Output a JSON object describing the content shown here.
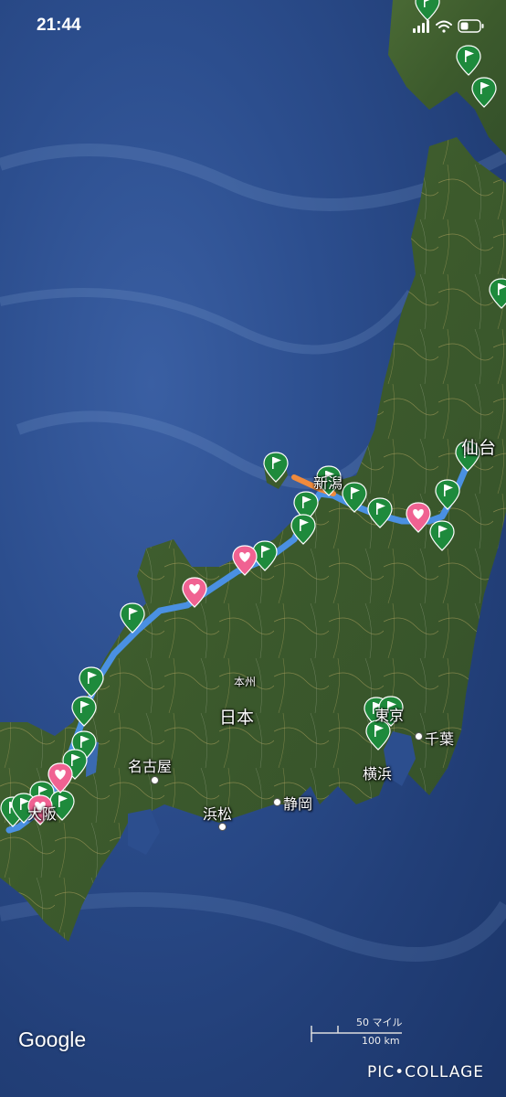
{
  "status_bar": {
    "time": "21:44"
  },
  "labels": {
    "sendai": "仙台",
    "niigata": "新潟",
    "honshu": "本州",
    "japan": "日本",
    "tokyo": "東京",
    "chiba": "千葉",
    "yokohama": "横浜",
    "nagoya": "名古屋",
    "hamamatsu": "浜松",
    "shizuoka": "静岡",
    "osaka": "大阪"
  },
  "attribution": {
    "logo": "Google"
  },
  "scale": {
    "imperial": "50 マイル",
    "metric": "100 km"
  },
  "watermark": "PIC•COLLAGE",
  "colors": {
    "route_primary": "#4a90e2",
    "route_secondary": "#f08a3c",
    "marker_flag": "#1e8a3c",
    "marker_heart": "#f06292",
    "ocean": "#2c4e8e",
    "land": "#3d5a2f"
  },
  "markers": {
    "flag_icon": "flag-icon",
    "heart_icon": "heart-icon"
  }
}
